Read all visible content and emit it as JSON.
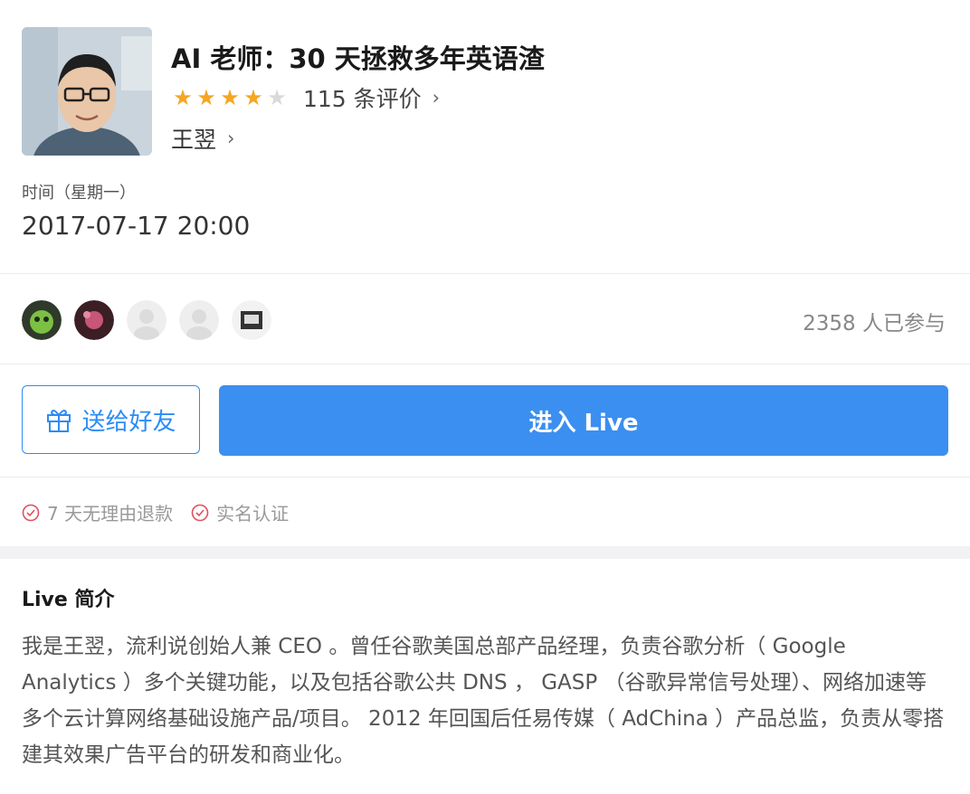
{
  "course": {
    "title": "AI 老师：30 天拯救多年英语渣",
    "rating": {
      "value": 4,
      "max": 5,
      "reviews_label": "115 条评价"
    },
    "author": "王翌"
  },
  "schedule": {
    "label": "时间（星期一）",
    "datetime": "2017-07-17 20:00"
  },
  "participants": {
    "count_label": "2358 人已参与",
    "avatars": [
      "participant-avatar-1",
      "participant-avatar-2",
      "participant-avatar-3",
      "participant-avatar-4",
      "participant-avatar-5"
    ]
  },
  "actions": {
    "gift_label": "送给好友",
    "enter_label": "进入 Live"
  },
  "assurances": [
    "7 天无理由退款",
    "实名认证"
  ],
  "intro": {
    "title": "Live 简介",
    "body": "我是王翌，流利说创始人兼 CEO 。曾任谷歌美国总部产品经理，负责谷歌分析（ Google Analytics ）多个关键功能，以及包括谷歌公共 DNS ， GASP （谷歌异常信号处理）、网络加速等多个云计算网络基础设施产品/项目。 2012 年回国后任易传媒（ AdChina ）产品总监，负责从零搭建其效果广告平台的研发和商业化。"
  },
  "colors": {
    "accent": "#3b8ff0",
    "star": "#f5a623",
    "check": "#e0505e"
  }
}
